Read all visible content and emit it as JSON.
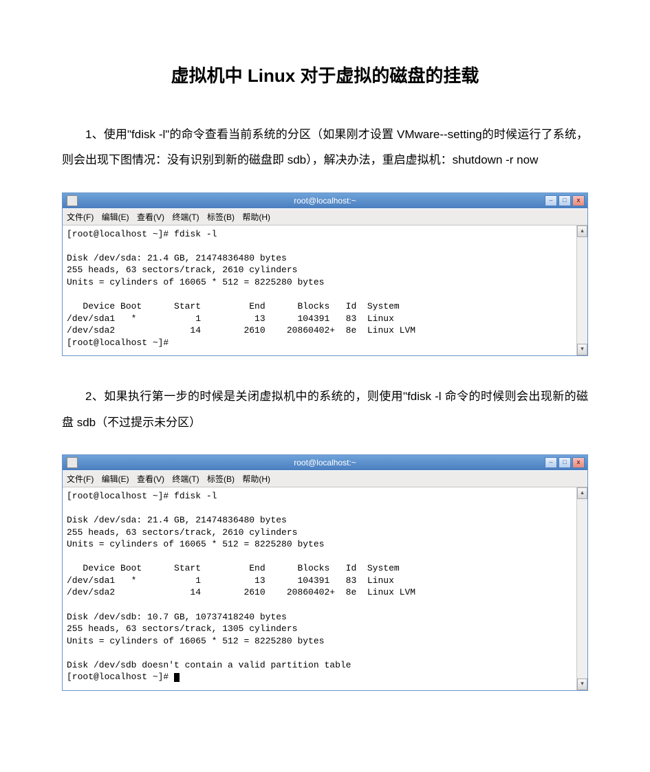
{
  "title": "虚拟机中 Linux 对于虚拟的磁盘的挂载",
  "para1": "1、使用\"fdisk -l\"的命令查看当前系统的分区（如果刚才设置 VMware--setting的时候运行了系统，则会出现下图情况：没有识别到新的磁盘即 sdb），解决办法，重启虚拟机：shutdown -r now",
  "para2": "2、如果执行第一步的时候是关闭虚拟机中的系统的，则使用\"fdisk -l 命令的时候则会出现新的磁盘 sdb（不过提示未分区）",
  "term": {
    "window_title": "root@localhost:~",
    "menu": {
      "file": "文件(F)",
      "edit": "编辑(E)",
      "view": "查看(V)",
      "terminal": "终端(T)",
      "tabs": "标签(B)",
      "help": "帮助(H)"
    },
    "win_minimize": "–",
    "win_maximize": "□",
    "win_close": "x",
    "scroll_up": "▴",
    "scroll_down": "▾"
  },
  "term1_content": "[root@localhost ~]# fdisk -l\n\nDisk /dev/sda: 21.4 GB, 21474836480 bytes\n255 heads, 63 sectors/track, 2610 cylinders\nUnits = cylinders of 16065 * 512 = 8225280 bytes\n\n   Device Boot      Start         End      Blocks   Id  System\n/dev/sda1   *           1          13      104391   83  Linux\n/dev/sda2              14        2610    20860402+  8e  Linux LVM\n[root@localhost ~]#",
  "term2_content": "[root@localhost ~]# fdisk -l\n\nDisk /dev/sda: 21.4 GB, 21474836480 bytes\n255 heads, 63 sectors/track, 2610 cylinders\nUnits = cylinders of 16065 * 512 = 8225280 bytes\n\n   Device Boot      Start         End      Blocks   Id  System\n/dev/sda1   *           1          13      104391   83  Linux\n/dev/sda2              14        2610    20860402+  8e  Linux LVM\n\nDisk /dev/sdb: 10.7 GB, 10737418240 bytes\n255 heads, 63 sectors/track, 1305 cylinders\nUnits = cylinders of 16065 * 512 = 8225280 bytes\n\nDisk /dev/sdb doesn't contain a valid partition table\n[root@localhost ~]# "
}
